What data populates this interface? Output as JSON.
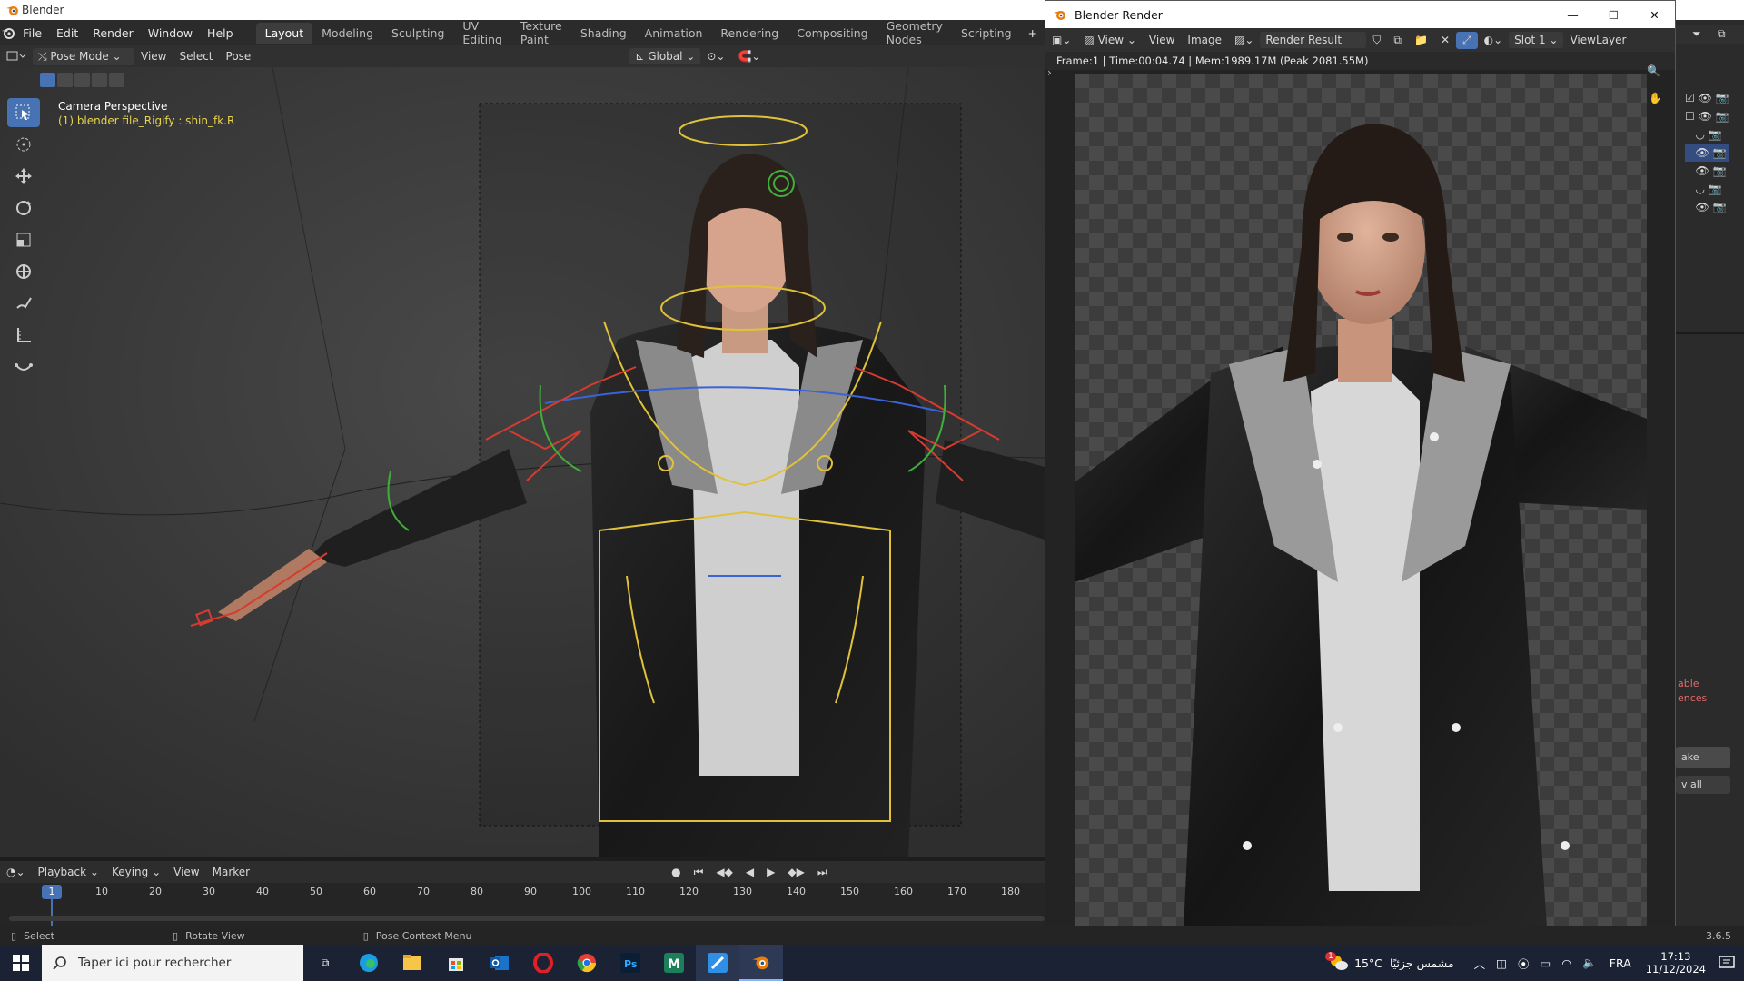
{
  "os_window": {
    "title": "Blender"
  },
  "menu": [
    "File",
    "Edit",
    "Render",
    "Window",
    "Help"
  ],
  "workspaces": [
    {
      "label": "Layout",
      "active": true
    },
    {
      "label": "Modeling"
    },
    {
      "label": "Sculpting"
    },
    {
      "label": "UV Editing"
    },
    {
      "label": "Texture Paint"
    },
    {
      "label": "Shading"
    },
    {
      "label": "Animation"
    },
    {
      "label": "Rendering"
    },
    {
      "label": "Compositing"
    },
    {
      "label": "Geometry Nodes"
    },
    {
      "label": "Scripting"
    }
  ],
  "header": {
    "mode": "Pose Mode",
    "view": "View",
    "select": "Select",
    "pose": "Pose",
    "orientation": "Global"
  },
  "viewport": {
    "camera_label": "Camera Perspective",
    "object_label": "(1) blender file_Rigify : shin_fk.R"
  },
  "timeline": {
    "menus": [
      "Playback",
      "Keying",
      "View",
      "Marker"
    ],
    "current_frame": "1",
    "ticks": [
      "10",
      "20",
      "30",
      "40",
      "50",
      "60",
      "70",
      "80",
      "90",
      "100",
      "110",
      "120",
      "130",
      "140",
      "150",
      "160",
      "170",
      "180"
    ]
  },
  "status_bar": {
    "select": "Select",
    "rotate": "Rotate View",
    "context": "Pose Context Menu",
    "version": "3.6.5"
  },
  "render_window": {
    "title": "Blender Render",
    "view": "View",
    "view2": "View",
    "image": "Image",
    "image_name": "Render Result",
    "slot": "Slot 1",
    "layer": "ViewLayer",
    "info": "Frame:1 | Time:00:04.74 | Mem:1989.17M (Peak 2081.55M)"
  },
  "right_panel": {
    "text1": "able",
    "text2": "ences",
    "btn1": "ake",
    "btn2": "v all"
  },
  "taskbar": {
    "search_placeholder": "Taper ici pour rechercher",
    "weather_temp": "15°C",
    "weather_text": "مشمس جزئيًا",
    "lang": "FRA",
    "time": "17:13",
    "date": "11/12/2024",
    "notif_count": "1"
  },
  "colors": {
    "accent": "#4772b3",
    "rig_yellow": "#e0c23a",
    "rig_red": "#d63b2f",
    "rig_green": "#3fae3a",
    "rig_blue": "#3a63d6"
  }
}
